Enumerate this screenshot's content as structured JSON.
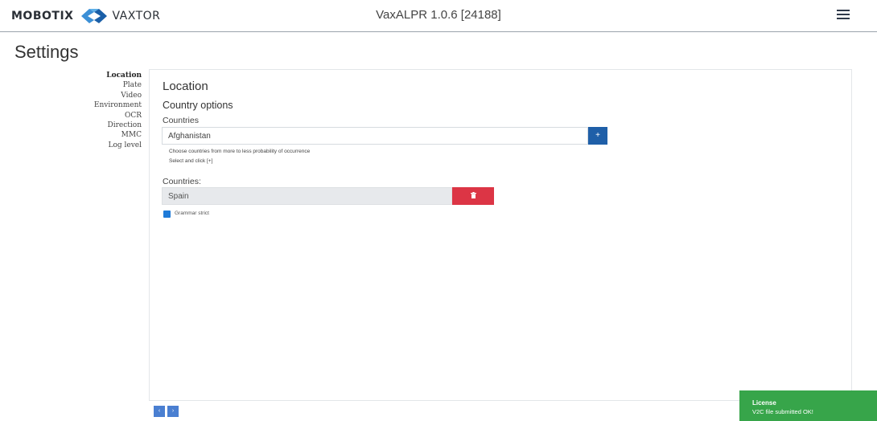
{
  "header": {
    "brand_left": "MOBOTIX",
    "brand_right": "VAXTOR",
    "app_title": "VaxALPR 1.0.6 [24188]",
    "menu_icon": "hamburger-menu-icon"
  },
  "page": {
    "title": "Settings"
  },
  "sidebar": {
    "items": [
      {
        "label": "Location",
        "active": true
      },
      {
        "label": "Plate"
      },
      {
        "label": "Video"
      },
      {
        "label": "Environment"
      },
      {
        "label": "OCR"
      },
      {
        "label": "Direction"
      },
      {
        "label": "MMC"
      },
      {
        "label": "Log level"
      }
    ]
  },
  "location": {
    "section_title": "Location",
    "subsection_title": "Country options",
    "countries_label": "Countries",
    "selected_option": "Afghanistan",
    "add_label": "+",
    "help_1": "Choose countries from more to less probability of occurrence",
    "help_2": "Select and click [+]",
    "list_label": "Countries:",
    "list_items": [
      "Spain"
    ],
    "delete_icon": "trash-icon",
    "checkbox_label": "Grammar strict",
    "checkbox_checked": true
  },
  "pager": {
    "prev": "‹",
    "next": "›"
  },
  "toast": {
    "title": "License",
    "message": "V2C file submitted OK!",
    "color": "#37a54a"
  },
  "colors": {
    "primary": "#1f5fa8",
    "danger": "#dc3545",
    "success": "#37a54a"
  }
}
